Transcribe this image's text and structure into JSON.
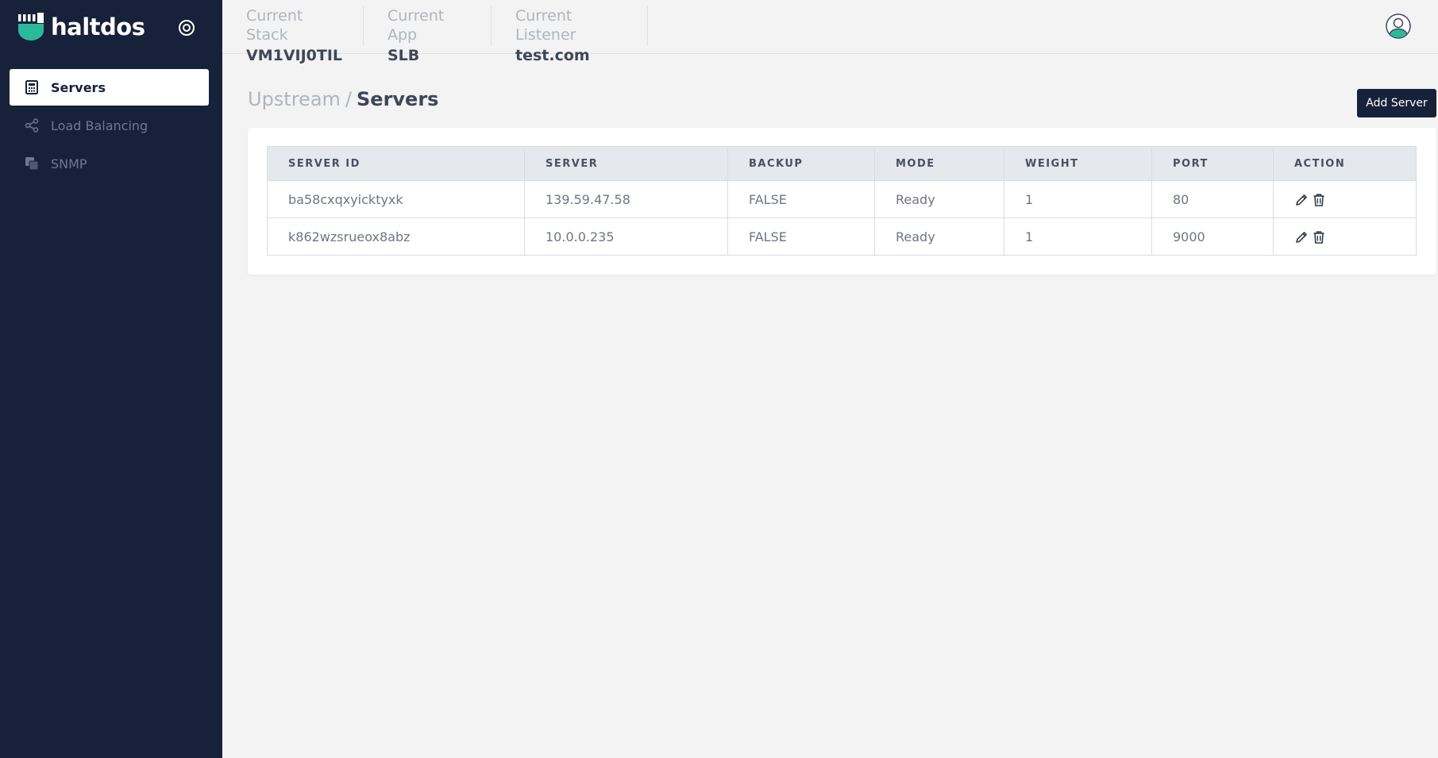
{
  "brand": {
    "name": "haltdos",
    "accent": "#2bb99b"
  },
  "sidebar": {
    "toggle_icon": "target-icon",
    "items": [
      {
        "label": "Servers",
        "icon": "calculator-icon",
        "active": true
      },
      {
        "label": "Load Balancing",
        "icon": "share-icon",
        "active": false
      },
      {
        "label": "SNMP",
        "icon": "layers-icon",
        "active": false
      }
    ]
  },
  "header": {
    "context": [
      {
        "label": "Current Stack",
        "value": "VM1VIJ0TIL"
      },
      {
        "label": "Current App",
        "value": "SLB"
      },
      {
        "label": "Current Listener",
        "value": "test.com"
      }
    ],
    "avatar_icon": "user-avatar-icon"
  },
  "main": {
    "breadcrumb": {
      "parent": "Upstream",
      "separator": "/",
      "current": "Servers"
    },
    "add_button_label": "Add Server",
    "table": {
      "columns": [
        "SERVER ID",
        "SERVER",
        "BACKUP",
        "MODE",
        "WEIGHT",
        "PORT",
        "ACTION"
      ],
      "rows": [
        {
          "server_id": "ba58cxqxyicktyxk",
          "server": "139.59.47.58",
          "backup": "FALSE",
          "mode": "Ready",
          "weight": "1",
          "port": "80"
        },
        {
          "server_id": "k862wzsrueox8abz",
          "server": "10.0.0.235",
          "backup": "FALSE",
          "mode": "Ready",
          "weight": "1",
          "port": "9000"
        }
      ],
      "row_actions": [
        "edit-icon",
        "delete-icon"
      ]
    }
  },
  "colors": {
    "sidebar_bg": "#18213a",
    "page_bg": "#f2f3f2",
    "button_bg": "#18213a",
    "table_header_bg": "#e5e8ec"
  }
}
